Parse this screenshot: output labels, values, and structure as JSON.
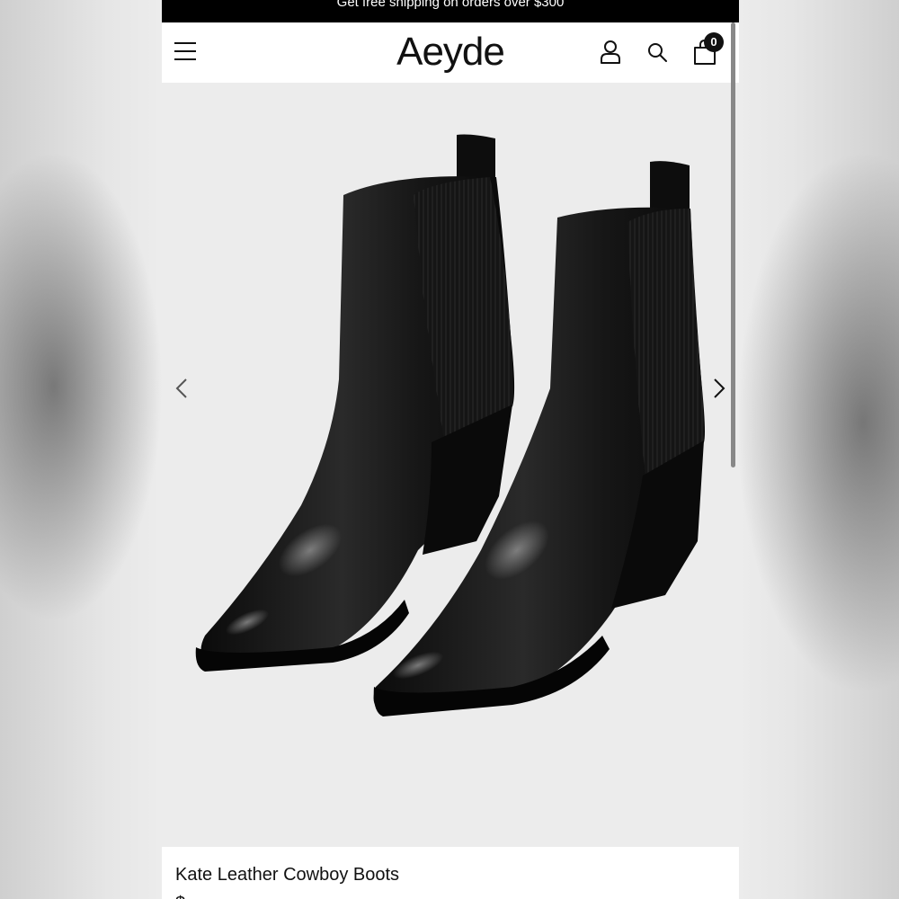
{
  "promo": {
    "text": "Get free shipping on orders over $300"
  },
  "header": {
    "logo": "Aeyde",
    "cart_count": "0",
    "icons": [
      "menu-icon",
      "account-icon",
      "search-icon",
      "shopping-bag-icon"
    ]
  },
  "gallery": {
    "image_alt": "Black leather pointed-toe cowboy ankle boots with elastic side panels and block heel",
    "prev_icon": "chevron-left-icon",
    "next_icon": "chevron-right-icon"
  },
  "product": {
    "title": "Kate Leather Cowboy Boots",
    "price": "$"
  },
  "colors": {
    "promo_bg": "#000000",
    "gallery_bg": "#ececec",
    "boot": "#111111"
  }
}
